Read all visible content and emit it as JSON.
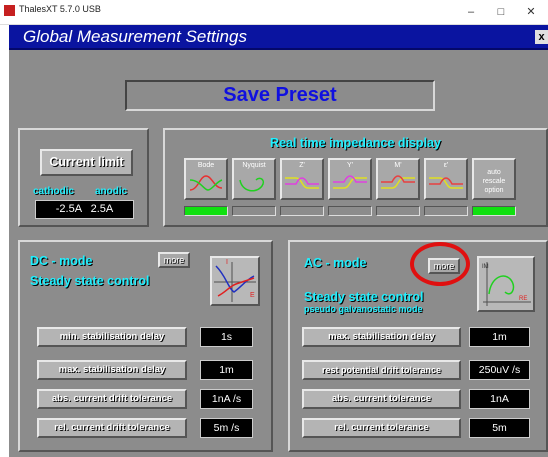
{
  "window": {
    "title": "ThalesXT 5.7.0 USB",
    "minimize": "–",
    "maximize": "□",
    "close": "✕"
  },
  "header": {
    "title": "Global Measurement Settings",
    "close": "x"
  },
  "save_preset": "Save Preset",
  "current_limit": {
    "button": "Current limit",
    "cathodic_label": "cathodic",
    "anodic_label": "anodic",
    "values": "-2.5A   2.5A"
  },
  "impedance": {
    "title": "Real time impedance display",
    "buttons": [
      {
        "label": "Bode",
        "on": true
      },
      {
        "label": "Nyquist",
        "on": false
      },
      {
        "label": "Z'",
        "on": false
      },
      {
        "label": "Y'",
        "on": false
      },
      {
        "label": "M'",
        "on": false
      },
      {
        "label": "ε'",
        "on": false
      },
      {
        "label": "auto rescale option",
        "on": true
      }
    ]
  },
  "dc": {
    "title": "DC - mode",
    "subtitle": "Steady state control",
    "more": "more",
    "graph_labels": {
      "i": "I",
      "e": "E"
    },
    "rows": [
      {
        "label": "min. stabilisation delay",
        "value": "1s"
      },
      {
        "label": "max. stabilisation delay",
        "value": "1m"
      },
      {
        "label": "abs. current drift tolerance",
        "value": "1nA /s"
      },
      {
        "label": "rel. current drift tolerance",
        "value": "5m /s"
      }
    ]
  },
  "ac": {
    "title": "AC - mode",
    "subtitle": "Steady state control",
    "subtitle2": "pseudo galvanostatic mode",
    "more": "more",
    "graph_labels": {
      "im": "IM",
      "re": "RE"
    },
    "rows": [
      {
        "label": "max. stabilisation delay",
        "value": "1m"
      },
      {
        "label": "rest potential drift tolerance",
        "value": "250uV /s"
      },
      {
        "label": "abs. current tolerance",
        "value": "1nA"
      },
      {
        "label": "rel. current tolerance",
        "value": "5m"
      }
    ]
  },
  "colors": {
    "header": "#0a14a0",
    "panel": "#8c8c8c",
    "label_cyan": "#20f0ff",
    "save_text": "#1010e0",
    "indicator_on": "#10e010",
    "highlight": "#e01010"
  }
}
